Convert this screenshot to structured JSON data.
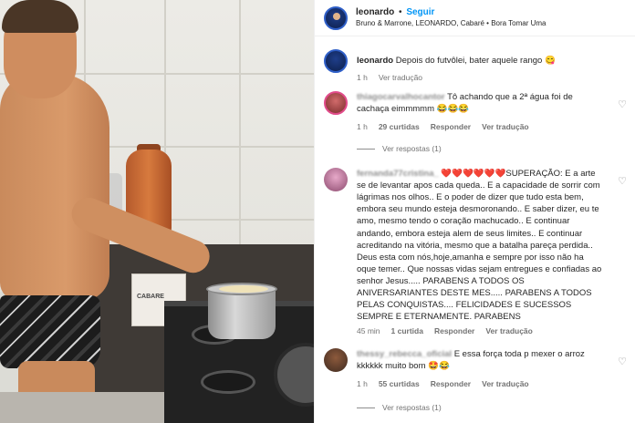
{
  "post": {
    "username": "leonardo",
    "follow_label": "Seguir",
    "subtitle": "Bruno & Marrone, LEONARDO, Cabaré • Bora Tomar Uma",
    "photo_box_label": "CABARE"
  },
  "caption": {
    "username": "leonardo",
    "text": "Depois do futvôlei, bater aquele rango 😋",
    "time": "1 h",
    "translate": "Ver tradução"
  },
  "comments": [
    {
      "username": "thiagocarvalhocantor",
      "text": "Tô achando que a 2ª água foi de cachaça eimmmmm 😂😂😂",
      "time": "1 h",
      "likes": "29 curtidas",
      "reply": "Responder",
      "translate": "Ver tradução",
      "view_replies": "Ver respostas (1)"
    },
    {
      "username": "fernanda77cristina_",
      "text": "❤️❤️❤️❤️❤️❤️SUPERAÇÃO: E a arte se de levantar apos cada queda.. E a capacidade de sorrir com lágrimas nos olhos.. E o poder de dizer que tudo esta bem, embora seu mundo esteja desmoronando.. E saber dizer, eu te amo, mesmo tendo o coração machucado.. E continuar andando, embora esteja alem de seus limites.. E continuar acreditando na vitória, mesmo que a batalha pareça perdida.. Deus esta com nós,hoje,amanha e sempre por isso não ha oque temer.. Que nossas vidas sejam entregues e confiadas ao senhor Jesus..... PARABENS A TODOS OS ANIVERSARIANTES DESTE MES..... PARABENS A TODOS PELAS CONQUISTAS.... FELICIDADES E SUCESSOS SEMPRE E ETERNAMENTE. PARABENS",
      "time": "45 min",
      "likes": "1 curtida",
      "reply": "Responder",
      "translate": "Ver tradução"
    },
    {
      "username": "thessy_rebecca_oficial",
      "text": "E essa força toda p mexer o arroz kkkkkk muito bom 🤩😂",
      "time": "1 h",
      "likes": "55 curtidas",
      "reply": "Responder",
      "translate": "Ver tradução",
      "view_replies": "Ver respostas (1)"
    }
  ],
  "icons": {
    "like": "heart-icon"
  }
}
